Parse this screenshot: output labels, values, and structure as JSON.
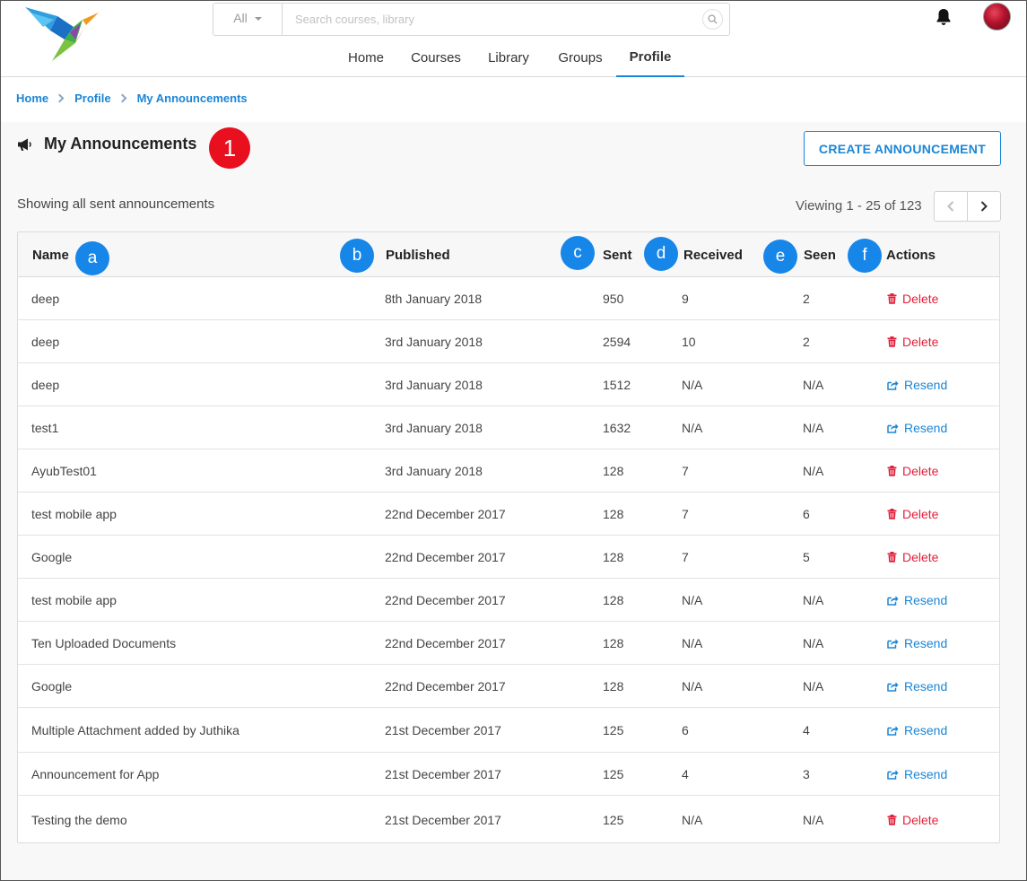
{
  "header": {
    "search_filter": "All",
    "search_placeholder": "Search courses, library"
  },
  "nav": {
    "items": [
      {
        "label": "Home"
      },
      {
        "label": "Courses"
      },
      {
        "label": "Library"
      },
      {
        "label": "Groups"
      },
      {
        "label": "Profile",
        "active": true
      }
    ]
  },
  "breadcrumb": [
    "Home",
    "Profile",
    "My Announcements"
  ],
  "page": {
    "title": "My Announcements",
    "title_marker": "1",
    "create_button": "CREATE ANNOUNCEMENT",
    "subtitle": "Showing all sent announcements",
    "viewing": "Viewing 1 - 25 of 123"
  },
  "table": {
    "columns": [
      {
        "label": "Name",
        "marker": "a"
      },
      {
        "label": "Published",
        "marker": "b"
      },
      {
        "label": "Sent",
        "marker": "c"
      },
      {
        "label": "Received",
        "marker": "d"
      },
      {
        "label": "Seen",
        "marker": "e"
      },
      {
        "label": "Actions",
        "marker": "f"
      }
    ],
    "rows": [
      {
        "name": "deep",
        "published": "8th January 2018",
        "sent": "950",
        "received": "9",
        "seen": "2",
        "action": "Delete"
      },
      {
        "name": "deep",
        "published": "3rd January 2018",
        "sent": "2594",
        "received": "10",
        "seen": "2",
        "action": "Delete"
      },
      {
        "name": "deep",
        "published": "3rd January 2018",
        "sent": "1512",
        "received": "N/A",
        "seen": "N/A",
        "action": "Resend"
      },
      {
        "name": "test1",
        "published": "3rd January 2018",
        "sent": "1632",
        "received": "N/A",
        "seen": "N/A",
        "action": "Resend"
      },
      {
        "name": "AyubTest01",
        "published": "3rd January 2018",
        "sent": "128",
        "received": "7",
        "seen": "N/A",
        "action": "Delete"
      },
      {
        "name": "test mobile app",
        "published": "22nd December 2017",
        "sent": "128",
        "received": "7",
        "seen": "6",
        "action": "Delete"
      },
      {
        "name": "Google",
        "published": "22nd December 2017",
        "sent": "128",
        "received": "7",
        "seen": "5",
        "action": "Delete"
      },
      {
        "name": "test mobile app",
        "published": "22nd December 2017",
        "sent": "128",
        "received": "N/A",
        "seen": "N/A",
        "action": "Resend"
      },
      {
        "name": "Ten Uploaded Documents",
        "published": "22nd December 2017",
        "sent": "128",
        "received": "N/A",
        "seen": "N/A",
        "action": "Resend"
      },
      {
        "name": "Google",
        "published": "22nd December 2017",
        "sent": "128",
        "received": "N/A",
        "seen": "N/A",
        "action": "Resend"
      },
      {
        "name": "Multiple Attachment added by Juthika",
        "published": "21st December 2017",
        "sent": "125",
        "received": "6",
        "seen": "4",
        "action": "Resend"
      },
      {
        "name": "Announcement for App",
        "published": "21st December 2017",
        "sent": "125",
        "received": "4",
        "seen": "3",
        "action": "Resend"
      },
      {
        "name": "Testing the demo",
        "published": "21st December 2017",
        "sent": "125",
        "received": "N/A",
        "seen": "N/A",
        "action": "Delete"
      }
    ]
  },
  "colors": {
    "accent": "#1a86d6",
    "delete": "#e0213c",
    "marker_blue": "#1686e8",
    "marker_red": "#e8101e"
  }
}
